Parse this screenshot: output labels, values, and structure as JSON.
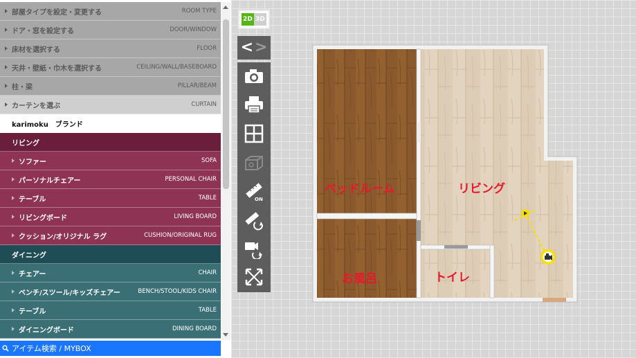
{
  "menu": {
    "top_items": [
      {
        "jp": "部屋タイプを設定・変更する",
        "en": "ROOM TYPE"
      },
      {
        "jp": "ドア・窓を設定する",
        "en": "DOOR/WINDOW"
      },
      {
        "jp": "床材を選択する",
        "en": "FLOOR"
      },
      {
        "jp": "天井・壁紙・巾木を選択する",
        "en": "CEILING/WALL/BASEBOARD"
      },
      {
        "jp": "柱・梁",
        "en": "PILLAR/BEAM"
      },
      {
        "jp": "カーテンを選ぶ",
        "en": "CURTAIN"
      }
    ],
    "brand": "karimoku　ブランド",
    "living": {
      "title": "リビング",
      "items": [
        {
          "jp": "ソファー",
          "en": "SOFA"
        },
        {
          "jp": "パーソナルチェアー",
          "en": "PERSONAL CHAIR"
        },
        {
          "jp": "テーブル",
          "en": "TABLE"
        },
        {
          "jp": "リビングボード",
          "en": "LIVING BOARD"
        },
        {
          "jp": "クッション/オリジナル ラグ",
          "en": "CUSHION/ORIGINAL RUG"
        }
      ]
    },
    "dining": {
      "title": "ダイニング",
      "items": [
        {
          "jp": "チェアー",
          "en": "CHAIR"
        },
        {
          "jp": "ベンチ/スツール/キッズチェアー",
          "en": "BENCH/STOOL/KIDS CHAIR"
        },
        {
          "jp": "テーブル",
          "en": "TABLE"
        },
        {
          "jp": "ダイニングボード",
          "en": "DINING BOARD"
        }
      ]
    },
    "search": "アイテム検索 / MYBOX"
  },
  "view_toggle": {
    "mode_2d": "2D",
    "mode_3d": "3D",
    "active": "2D"
  },
  "arrows": {
    "back": "<",
    "forward": ">"
  },
  "tools": [
    "camera-icon",
    "print-icon",
    "grid-layout-icon",
    "3d-box-icon",
    "ruler-on-icon",
    "ruler-rotate-icon",
    "camera-rotate-icon",
    "fit-screen-icon"
  ],
  "rooms": {
    "bedroom": "ベッドルーム",
    "living": "リビング",
    "bath": "お風呂",
    "toilet": "トイレ"
  },
  "colors": {
    "accent_green": "#56b714",
    "living_category": "#6b1d3c",
    "dining_category": "#1f4d55",
    "search_bar": "#1a76ff",
    "room_label": "#e8192c"
  }
}
